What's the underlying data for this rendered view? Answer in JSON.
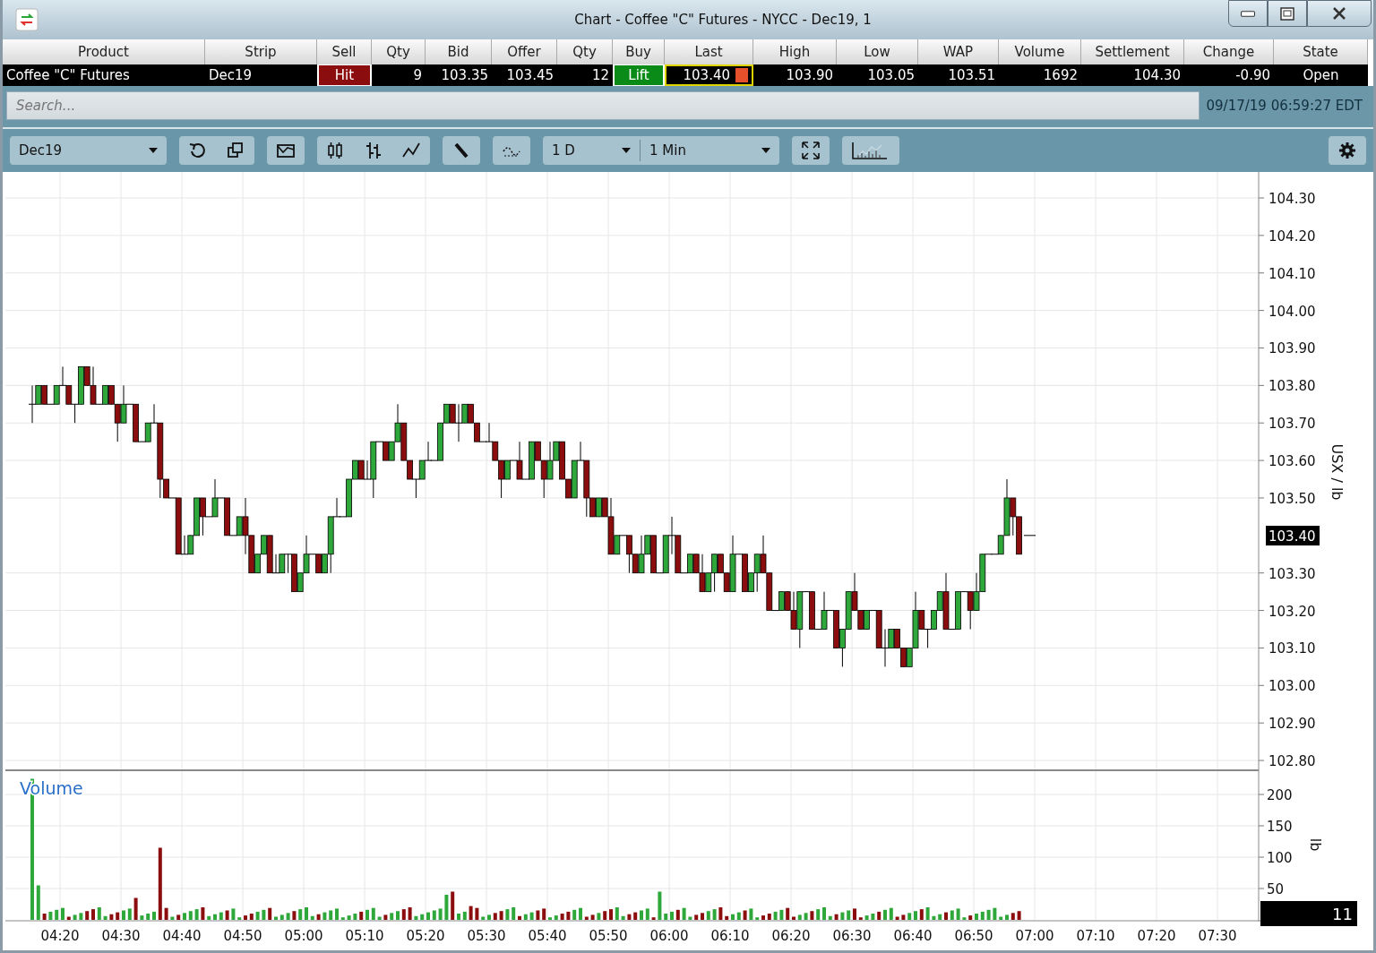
{
  "window": {
    "title": "Chart - Coffee \"C\" Futures - NYCC - Dec19, 1"
  },
  "quote_table": {
    "columns": [
      "Product",
      "Strip",
      "Sell",
      "Qty",
      "Bid",
      "Offer",
      "Qty",
      "Buy",
      "Last",
      "High",
      "Low",
      "WAP",
      "Volume",
      "Settlement",
      "Change",
      "State"
    ],
    "row": [
      {
        "kind": "text",
        "text": "Coffee \"C\" Futures"
      },
      {
        "kind": "text",
        "text": "Dec19"
      },
      {
        "kind": "sell",
        "text": "Hit"
      },
      {
        "kind": "num",
        "text": "9"
      },
      {
        "kind": "num",
        "text": "103.35"
      },
      {
        "kind": "num",
        "text": "103.45"
      },
      {
        "kind": "num",
        "text": "12"
      },
      {
        "kind": "buy",
        "text": "Lift"
      },
      {
        "kind": "last",
        "text": "103.40"
      },
      {
        "kind": "num",
        "text": "103.90"
      },
      {
        "kind": "num",
        "text": "103.05"
      },
      {
        "kind": "num",
        "text": "103.51"
      },
      {
        "kind": "num",
        "text": "1692"
      },
      {
        "kind": "num",
        "text": "104.30"
      },
      {
        "kind": "num",
        "text": "-0.90"
      },
      {
        "kind": "center",
        "text": "Open"
      }
    ]
  },
  "search": {
    "placeholder": "Search...",
    "timestamp": "09/17/19 06:59:27 EDT"
  },
  "toolbar": {
    "strip": "Dec19",
    "period": "1 D",
    "interval": "1 Min"
  },
  "price_axis": {
    "ticks": [
      "104.30",
      "104.20",
      "104.10",
      "104.00",
      "103.90",
      "103.80",
      "103.70",
      "103.60",
      "103.50",
      "103.30",
      "103.20",
      "103.10",
      "103.00",
      "102.90",
      "102.80"
    ],
    "unit": "USX / lb",
    "last_price": "103.40"
  },
  "volume_panel": {
    "title": "Volume",
    "ticks": [
      "200",
      "150",
      "100",
      "50"
    ],
    "unit": "lb",
    "last_volume": "11"
  },
  "time_axis": [
    "04:20",
    "04:30",
    "04:40",
    "04:50",
    "05:00",
    "05:10",
    "05:20",
    "05:30",
    "05:40",
    "05:50",
    "06:00",
    "06:10",
    "06:20",
    "06:30",
    "06:40",
    "06:50",
    "07:00",
    "07:10",
    "07:20",
    "07:30"
  ]
}
